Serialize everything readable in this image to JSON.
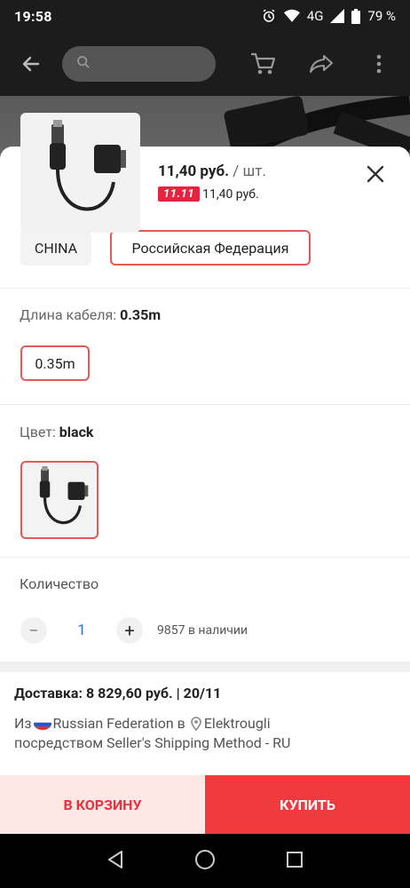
{
  "status_bar": {
    "time": "19:58",
    "network": "4G",
    "battery": "79 %"
  },
  "app_bar": {
    "back_icon": "arrow-left-icon",
    "search_icon": "search-icon",
    "cart_icon": "cart-icon",
    "share_icon": "share-icon",
    "more_icon": "more-vertical-icon"
  },
  "product": {
    "price": "11,40 руб.",
    "per_unit": "/ шт.",
    "sale_badge": "11.11",
    "sale_price": "11,40 руб."
  },
  "ship_from": {
    "options": [
      "CHINA",
      "Российская Федерация"
    ],
    "selected": "Российская Федерация"
  },
  "cable_length": {
    "label": "Длина кабеля: ",
    "value": "0.35m",
    "option": "0.35m"
  },
  "color": {
    "label": "Цвет: ",
    "value": "black"
  },
  "quantity": {
    "label": "Количество",
    "minus": "−",
    "value": "1",
    "plus": "+",
    "stock": "9857 в наличии"
  },
  "shipping": {
    "title": "Доставка: 8 829,60 руб. | 20/11",
    "from_prefix": "Из",
    "from_country": "Russian Federation в",
    "to_city": "Elektrougli",
    "method": "посредством Seller's Shipping Method - RU"
  },
  "buttons": {
    "add_to_cart": "В КОРЗИНУ",
    "buy": "КУПИТЬ"
  },
  "colors": {
    "accent": "#f03a3e",
    "cart_bg": "#fde8e6",
    "selected_border": "#e45a5a",
    "quantity_blue": "#2a73d8"
  }
}
